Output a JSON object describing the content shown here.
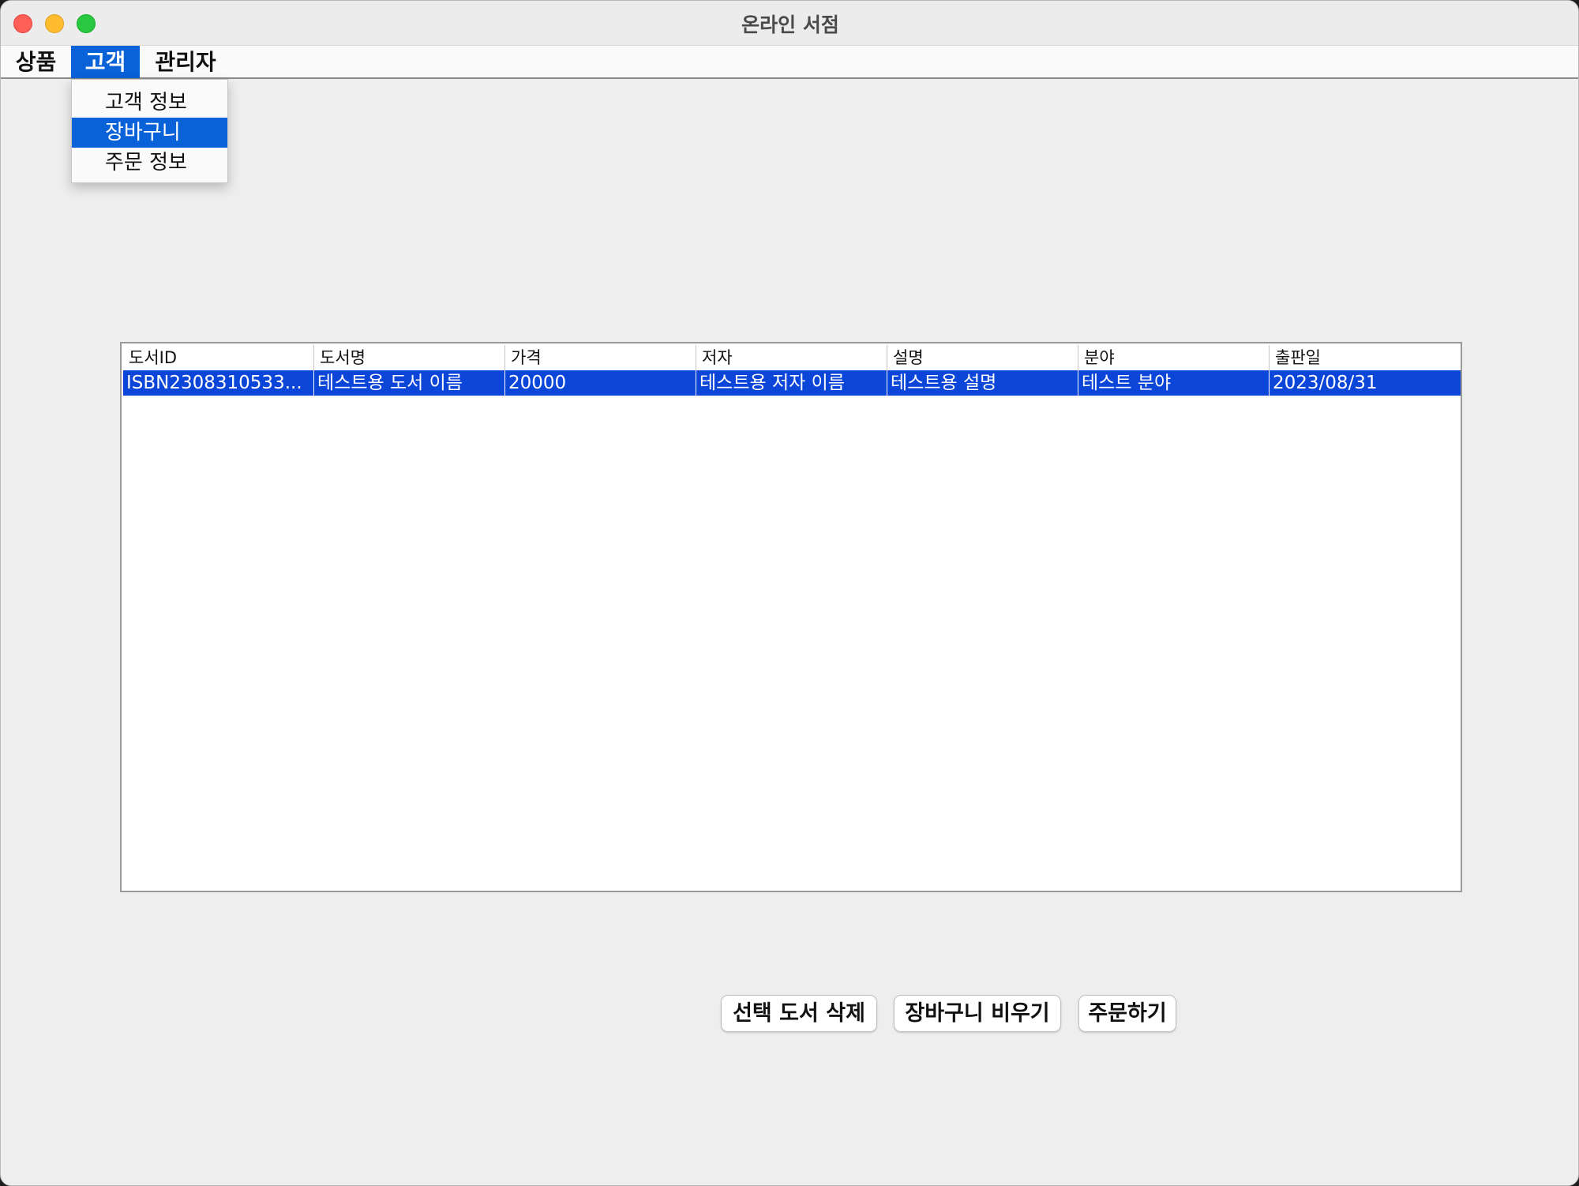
{
  "window": {
    "title": "온라인 서점"
  },
  "menubar": {
    "items": [
      {
        "label": "상품"
      },
      {
        "label": "고객"
      },
      {
        "label": "관리자"
      }
    ]
  },
  "dropdown": {
    "items": [
      {
        "label": "고객 정보"
      },
      {
        "label": "장바구니"
      },
      {
        "label": "주문 정보"
      }
    ]
  },
  "table": {
    "columns": [
      "도서ID",
      "도서명",
      "가격",
      "저자",
      "설명",
      "분야",
      "출판일"
    ],
    "rows": [
      [
        "ISBN2308310533...",
        "테스트용 도서 이름",
        "20000",
        "테스트용 저자 이름",
        "테스트용 설명",
        "테스트 분야",
        "2023/08/31"
      ]
    ]
  },
  "buttons": {
    "delete_selected": "선택 도서 삭제",
    "clear_cart": "장바구니 비우기",
    "order": "주문하기"
  },
  "colors": {
    "selection": "#0b46d9",
    "menu_highlight": "#0a62d8"
  }
}
